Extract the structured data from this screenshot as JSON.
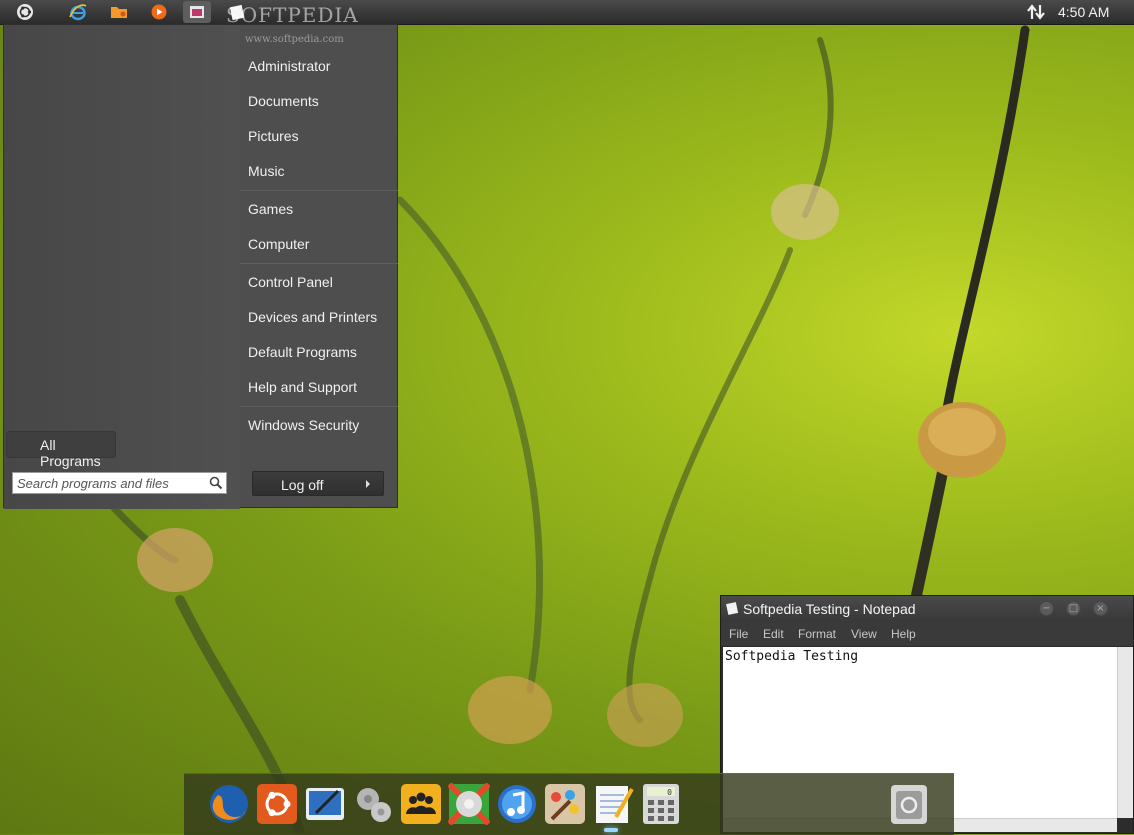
{
  "top_panel": {
    "brand_watermark": "SOFTPEDIA",
    "clock": "4:50 AM",
    "icons": [
      "ubuntu-logo-icon",
      "internet-explorer-icon",
      "file-manager-icon",
      "media-player-icon",
      "window-switcher-icon",
      "notepad-task-icon",
      "network-icon"
    ]
  },
  "start_menu": {
    "watermark": "www.softpedia.com",
    "places": [
      "Administrator",
      "Documents",
      "Pictures",
      "Music"
    ],
    "system": [
      "Games",
      "Computer"
    ],
    "settings": [
      "Control Panel",
      "Devices and Printers",
      "Default Programs",
      "Help and Support"
    ],
    "security": [
      "Windows Security"
    ],
    "all_programs_label": "All Programs",
    "search_placeholder": "Search programs and files",
    "logoff_label": "Log off"
  },
  "notepad": {
    "title": "Softpedia Testing - Notepad",
    "menu": [
      "File",
      "Edit",
      "Format",
      "View",
      "Help"
    ],
    "content": "Softpedia Testing"
  },
  "dock": {
    "items": [
      "firefox-icon",
      "ubuntu-icon",
      "desktop-pen-icon",
      "settings-gears-icon",
      "users-group-icon",
      "media-center-icon",
      "itunes-icon",
      "paint-icon",
      "notepad-icon",
      "calculator-icon",
      "trash-icon"
    ],
    "calculator_display": "0"
  },
  "colors": {
    "panel": "#2b2b2b",
    "menu": "#4e4e4e",
    "wallpaper": "#9cba1c",
    "dock": "#343a1c"
  }
}
